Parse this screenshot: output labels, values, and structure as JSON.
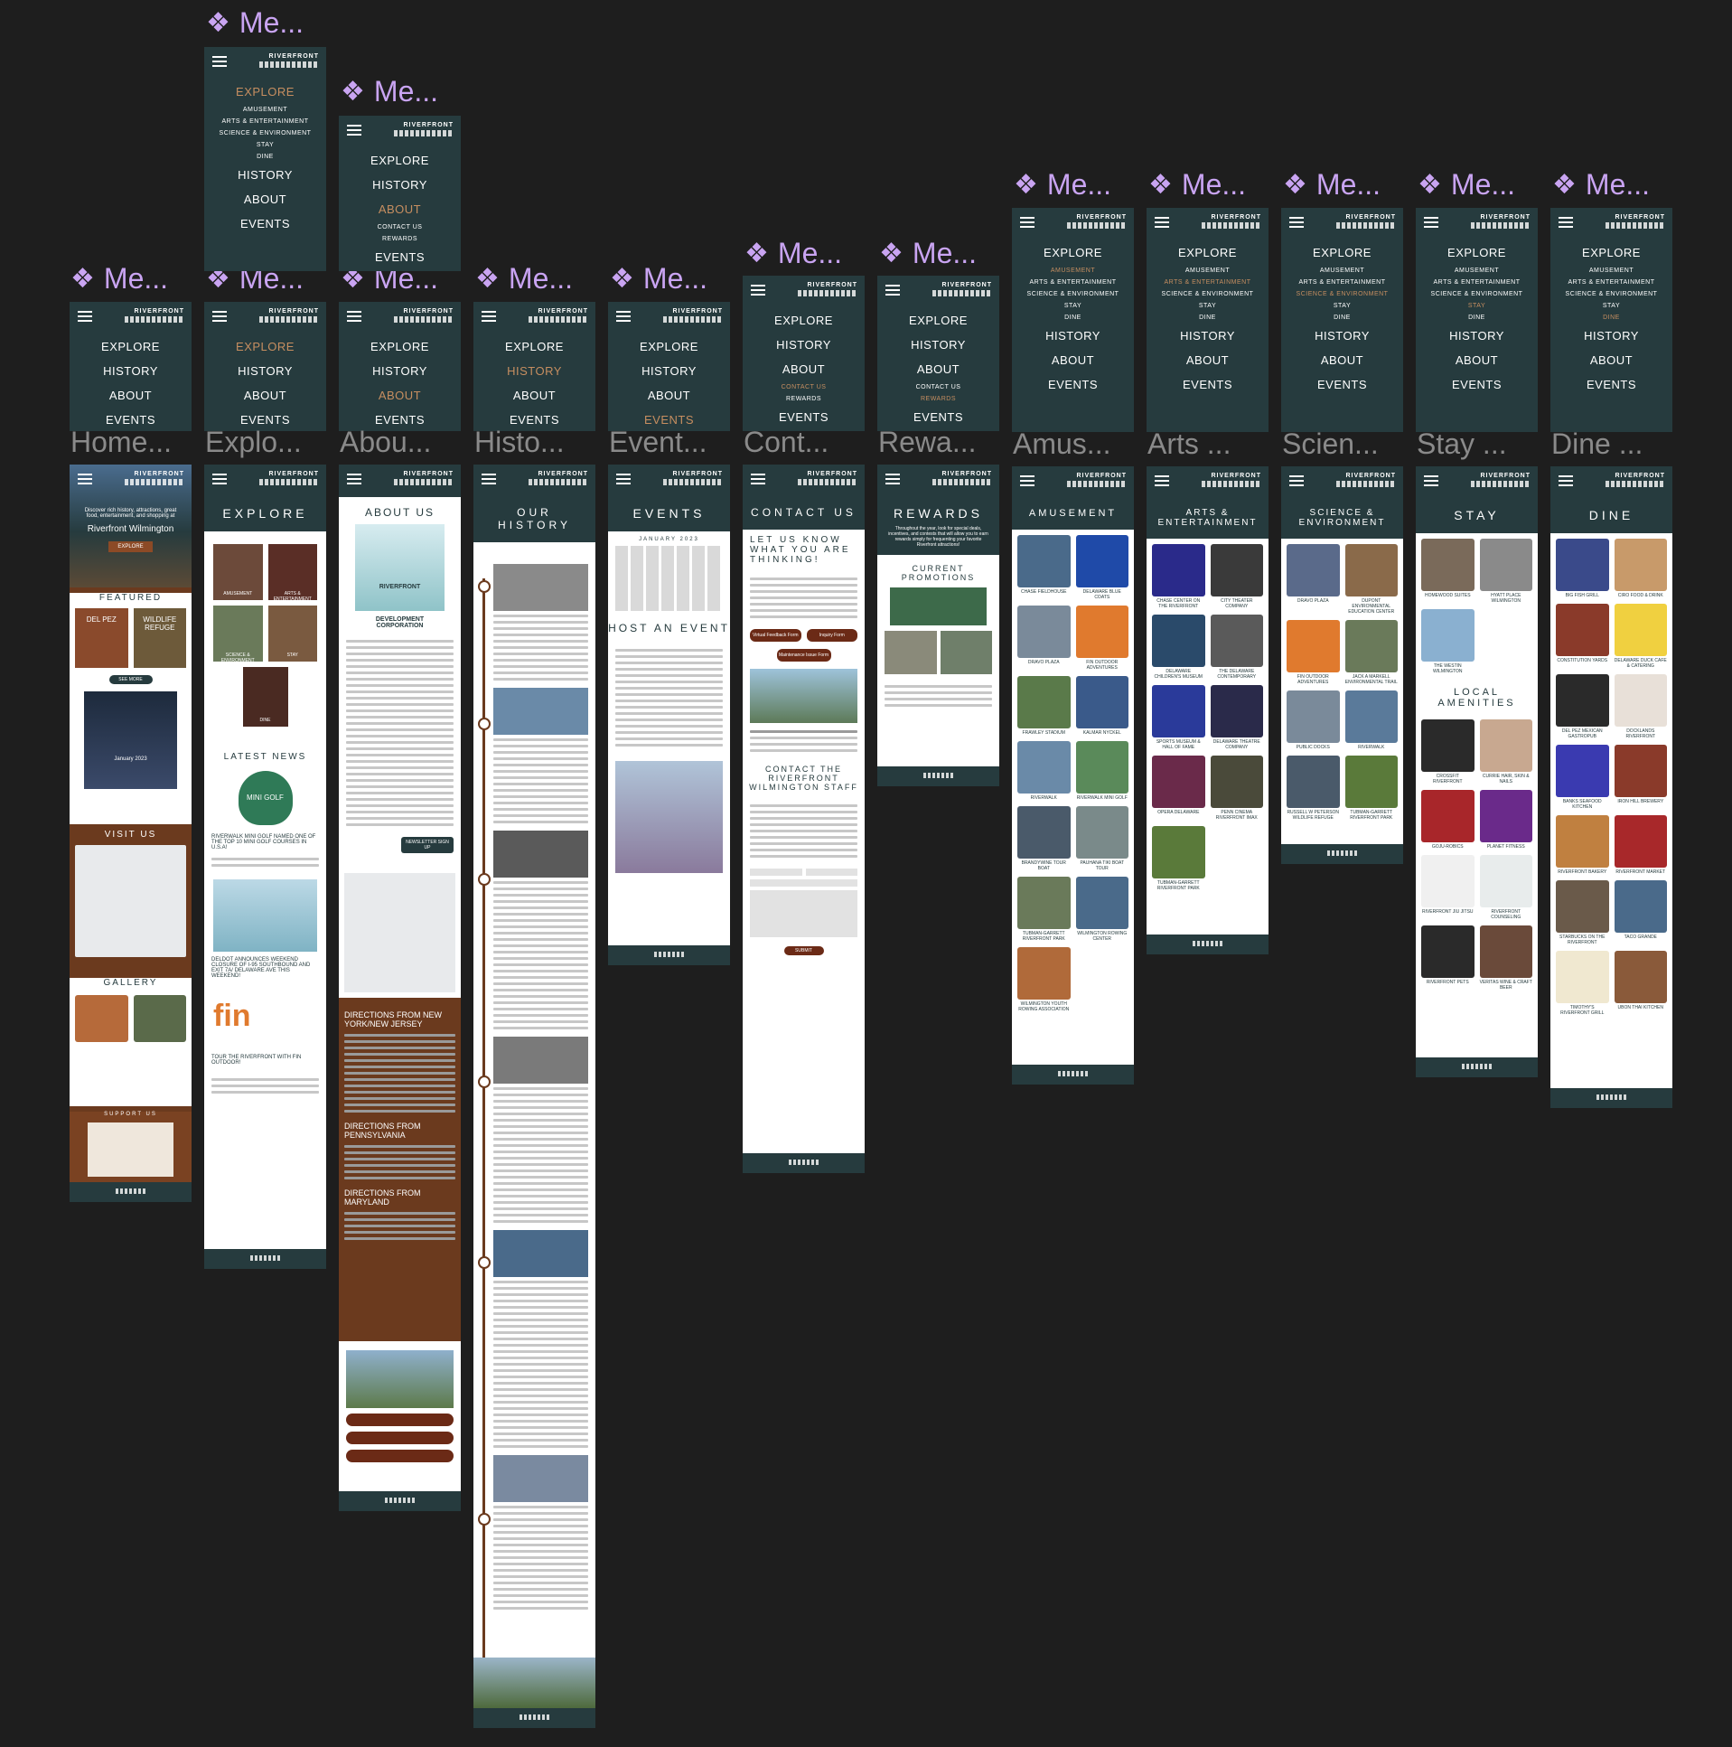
{
  "brand": {
    "logo_line1": "RIVERFRONT",
    "logo_line2": "WILMINGTON"
  },
  "frame_labels": [
    {
      "glyph": "❖",
      "text": "Me..."
    },
    {
      "glyph": "❖",
      "text": "Me..."
    },
    {
      "glyph": "❖",
      "text": "Me..."
    },
    {
      "glyph": "❖",
      "text": "Me..."
    },
    {
      "glyph": "❖",
      "text": "Me..."
    },
    {
      "glyph": "❖",
      "text": "Me..."
    },
    {
      "glyph": "❖",
      "text": "Me..."
    },
    {
      "glyph": "❖",
      "text": "Me..."
    },
    {
      "glyph": "❖",
      "text": "Me..."
    },
    {
      "glyph": "❖",
      "text": "Me..."
    },
    {
      "glyph": "❖",
      "text": "Me..."
    },
    {
      "glyph": "❖",
      "text": "Me..."
    },
    {
      "glyph": "❖",
      "text": "Me..."
    },
    {
      "glyph": "❖",
      "text": "Me..."
    },
    {
      "glyph": "❖",
      "text": "Me..."
    }
  ],
  "page_labels": [
    "Home...",
    "Explo...",
    "Abou...",
    "Histo...",
    "Event...",
    "Cont...",
    "Rewa...",
    "Amus...",
    "Arts ...",
    "Scien...",
    "Stay ...",
    "Dine ..."
  ],
  "menus": {
    "explore_expanded": [
      {
        "t": "EXPLORE",
        "sub": false,
        "on": true
      },
      {
        "t": "AMUSEMENT",
        "sub": true
      },
      {
        "t": "ARTS & ENTERTAINMENT",
        "sub": true
      },
      {
        "t": "SCIENCE & ENVIRONMENT",
        "sub": true
      },
      {
        "t": "STAY",
        "sub": true
      },
      {
        "t": "DINE",
        "sub": true
      },
      {
        "t": "HISTORY"
      },
      {
        "t": "ABOUT"
      },
      {
        "t": "EVENTS"
      }
    ],
    "about_expanded": [
      {
        "t": "EXPLORE"
      },
      {
        "t": "HISTORY"
      },
      {
        "t": "ABOUT",
        "on": true
      },
      {
        "t": "CONTACT US",
        "sub": true
      },
      {
        "t": "REWARDS",
        "sub": true
      },
      {
        "t": "EVENTS"
      }
    ],
    "main": [
      {
        "t": "EXPLORE"
      },
      {
        "t": "HISTORY"
      },
      {
        "t": "ABOUT"
      },
      {
        "t": "EVENTS"
      }
    ],
    "main_explore_on": [
      {
        "t": "EXPLORE",
        "on": true
      },
      {
        "t": "HISTORY"
      },
      {
        "t": "ABOUT"
      },
      {
        "t": "EVENTS"
      }
    ],
    "main_about_on": [
      {
        "t": "EXPLORE"
      },
      {
        "t": "HISTORY"
      },
      {
        "t": "ABOUT",
        "on": true
      },
      {
        "t": "EVENTS"
      }
    ],
    "main_history_on": [
      {
        "t": "EXPLORE"
      },
      {
        "t": "HISTORY",
        "on": true
      },
      {
        "t": "ABOUT"
      },
      {
        "t": "EVENTS"
      }
    ],
    "main_events_on": [
      {
        "t": "EXPLORE"
      },
      {
        "t": "HISTORY"
      },
      {
        "t": "ABOUT"
      },
      {
        "t": "EVENTS",
        "on": true
      }
    ],
    "contact_on": [
      {
        "t": "EXPLORE"
      },
      {
        "t": "HISTORY"
      },
      {
        "t": "ABOUT"
      },
      {
        "t": "CONTACT US",
        "sub": true,
        "on": true
      },
      {
        "t": "REWARDS",
        "sub": true
      },
      {
        "t": "EVENTS"
      }
    ],
    "rewards_on": [
      {
        "t": "EXPLORE"
      },
      {
        "t": "HISTORY"
      },
      {
        "t": "ABOUT"
      },
      {
        "t": "CONTACT US",
        "sub": true
      },
      {
        "t": "REWARDS",
        "sub": true,
        "on": true
      },
      {
        "t": "EVENTS"
      }
    ],
    "sub_amusement": [
      {
        "t": "EXPLORE"
      },
      {
        "t": "AMUSEMENT",
        "sub": true,
        "on": true
      },
      {
        "t": "ARTS & ENTERTAINMENT",
        "sub": true
      },
      {
        "t": "SCIENCE & ENVIRONMENT",
        "sub": true
      },
      {
        "t": "STAY",
        "sub": true
      },
      {
        "t": "DINE",
        "sub": true
      },
      {
        "t": "HISTORY"
      },
      {
        "t": "ABOUT"
      },
      {
        "t": "EVENTS"
      }
    ],
    "sub_arts": [
      {
        "t": "EXPLORE"
      },
      {
        "t": "AMUSEMENT",
        "sub": true
      },
      {
        "t": "ARTS & ENTERTAINMENT",
        "sub": true,
        "on": true
      },
      {
        "t": "SCIENCE & ENVIRONMENT",
        "sub": true
      },
      {
        "t": "STAY",
        "sub": true
      },
      {
        "t": "DINE",
        "sub": true
      },
      {
        "t": "HISTORY"
      },
      {
        "t": "ABOUT"
      },
      {
        "t": "EVENTS"
      }
    ],
    "sub_science": [
      {
        "t": "EXPLORE"
      },
      {
        "t": "AMUSEMENT",
        "sub": true
      },
      {
        "t": "ARTS & ENTERTAINMENT",
        "sub": true
      },
      {
        "t": "SCIENCE & ENVIRONMENT",
        "sub": true,
        "on": true
      },
      {
        "t": "STAY",
        "sub": true
      },
      {
        "t": "DINE",
        "sub": true
      },
      {
        "t": "HISTORY"
      },
      {
        "t": "ABOUT"
      },
      {
        "t": "EVENTS"
      }
    ],
    "sub_stay": [
      {
        "t": "EXPLORE"
      },
      {
        "t": "AMUSEMENT",
        "sub": true
      },
      {
        "t": "ARTS & ENTERTAINMENT",
        "sub": true
      },
      {
        "t": "SCIENCE & ENVIRONMENT",
        "sub": true
      },
      {
        "t": "STAY",
        "sub": true,
        "on": true
      },
      {
        "t": "DINE",
        "sub": true
      },
      {
        "t": "HISTORY"
      },
      {
        "t": "ABOUT"
      },
      {
        "t": "EVENTS"
      }
    ],
    "sub_dine": [
      {
        "t": "EXPLORE"
      },
      {
        "t": "AMUSEMENT",
        "sub": true
      },
      {
        "t": "ARTS & ENTERTAINMENT",
        "sub": true
      },
      {
        "t": "SCIENCE & ENVIRONMENT",
        "sub": true
      },
      {
        "t": "STAY",
        "sub": true
      },
      {
        "t": "DINE",
        "sub": true,
        "on": true
      },
      {
        "t": "HISTORY"
      },
      {
        "t": "ABOUT"
      },
      {
        "t": "EVENTS"
      }
    ]
  },
  "home": {
    "tagline": "Discover rich history, attractions, great food, entertainment, and shopping at",
    "title": "Riverfront Wilmington",
    "cta": "EXPLORE",
    "featured": "FEATURED",
    "feat1": "DEL PEZ",
    "feat2": "WILDLIFE REFUGE",
    "see_more": "SEE MORE",
    "calendar": "January 2023",
    "visit": "VISIT US",
    "gallery": "GALLERY",
    "support": "SUPPORT US"
  },
  "explore": {
    "title": "EXPLORE",
    "tiles": [
      "AMUSEMENT",
      "ARTS & ENTERTAINMENT",
      "SCIENCE & ENVIRONMENT",
      "STAY",
      "DINE"
    ],
    "news_title": "LATEST NEWS",
    "minigolf": "MINI GOLF",
    "news1": "RIVERWALK MINI GOLF NAMED ONE OF THE TOP 10 MINI GOLF COURSES IN U.S.A!",
    "news2": "DELDOT ANNOUNCES WEEKEND CLOSURE OF I-95 SOUTHBOUND AND EXIT 7A/ DELAWARE AVE THIS WEEKEND!",
    "fin": "fin",
    "news3": "TOUR THE RIVERFRONT WITH FIN OUTDOOR!"
  },
  "about": {
    "title": "ABOUT US",
    "org1": "RIVERFRONT",
    "org2": "DEVELOPMENT",
    "org3": "CORPORATION",
    "newsletter": "NEWSLETTER SIGN UP",
    "dir1": "DIRECTIONS FROM NEW YORK/NEW JERSEY",
    "dir2": "DIRECTIONS FROM PENNSYLVANIA",
    "dir3": "DIRECTIONS FROM MARYLAND"
  },
  "history": {
    "title": "OUR HISTORY"
  },
  "events": {
    "title": "EVENTS",
    "month": "JANUARY 2023",
    "host": "HOST AN EVENT"
  },
  "contact": {
    "title": "CONTACT US",
    "lead": "LET US KNOW WHAT YOU ARE THINKING!",
    "b1": "Virtual Feedback Form",
    "b2": "Inquiry Form",
    "b3": "Maintenance Issue Form",
    "staff": "CONTACT THE RIVERFRONT WILMINGTON STAFF",
    "submit": "SUBMIT"
  },
  "rewards": {
    "title": "REWARDS",
    "intro": "Throughout the year, look for special deals, incentives, and contests that will allow you to earn rewards simply for frequenting your favorite Riverfront attractions!",
    "promos": "CURRENT PROMOTIONS"
  },
  "amusement": {
    "title": "AMUSEMENT",
    "items": [
      "CHASE FIELDHOUSE",
      "DELAWARE BLUE COATS",
      "DRAVO PLAZA",
      "FIN OUTDOOR ADVENTURES",
      "FRAWLEY STADIUM",
      "KALMAR NYCKEL",
      "RIVERWALK",
      "RIVERWALK MINI GOLF",
      "BRANDYWINE TOUR BOAT",
      "PAUHANA TIKI BOAT TOUR",
      "TUBMAN-GARRETT RIVERFRONT PARK",
      "WILMINGTON ROWING CENTER",
      "WILMINGTON YOUTH ROWING ASSOCIATION"
    ]
  },
  "arts": {
    "title": "ARTS & ENTERTAINMENT",
    "items": [
      "CHASE CENTER ON THE RIVERFRONT",
      "CITY THEATER COMPANY",
      "DELAWARE CHILDREN'S MUSEUM",
      "THE DELAWARE CONTEMPORARY",
      "SPORTS MUSEUM & HALL OF FAME",
      "DELAWARE THEATRE COMPANY",
      "OPERA DELAWARE",
      "PENN CINEMA RIVERFRONT IMAX",
      "TUBMAN-GARRETT RIVERFRONT PARK"
    ]
  },
  "science": {
    "title": "SCIENCE & ENVIRONMENT",
    "items": [
      "DRAVO PLAZA",
      "DUPONT ENVIRONMENTAL EDUCATION CENTER",
      "FIN OUTDOOR ADVENTURES",
      "JACK A MARKELL ENVIRONMENTAL TRAIL",
      "PUBLIC DOCKS",
      "RIVERWALK",
      "RUSSELL W PETERSON WILDLIFE REFUGE",
      "TUBMAN-GARRETT RIVERFRONT PARK"
    ]
  },
  "stay": {
    "title": "STAY",
    "items": [
      "HOMEWOOD SUITES",
      "HYATT PLACE WILMINGTON",
      "THE WESTIN WILMINGTON"
    ],
    "local": "LOCAL AMENITIES",
    "amen": [
      "CROSSFIT RIVERFRONT",
      "CURRIE HAIR, SKIN & NAILS",
      "GOJU-ROBICS",
      "PLANET FITNESS",
      "RIVERFRONT JIU JITSU",
      "RIVERFRONT COUNSELING",
      "RIVERFRONT PETS",
      "VERITAS WINE & CRAFT BEER"
    ]
  },
  "dine": {
    "title": "DINE",
    "items": [
      "BIG FISH GRILL",
      "CIRO FOOD & DRINK",
      "CONSTITUTION YARDS",
      "DELAWARE DUCK CAFE & CATERING",
      "DEL PEZ MEXICAN GASTROPUB",
      "DOCKLANDS RIVERFRONT",
      "BANKS SEAFOOD KITCHEN",
      "IRON HILL BREWERY",
      "RIVERFRONT BAKERY",
      "RIVERFRONT MARKET",
      "STARBUCKS ON THE RIVERFRONT",
      "TACO GRANDE",
      "TIMOTHY'S RIVERFRONT GRILL",
      "UBON THAI KITCHEN"
    ]
  },
  "colors": {
    "bg": "#1e1e1e",
    "teal": "#263b3e",
    "accent": "#c68e60",
    "brown": "#6b2a16",
    "label": "#c9a4f2"
  }
}
